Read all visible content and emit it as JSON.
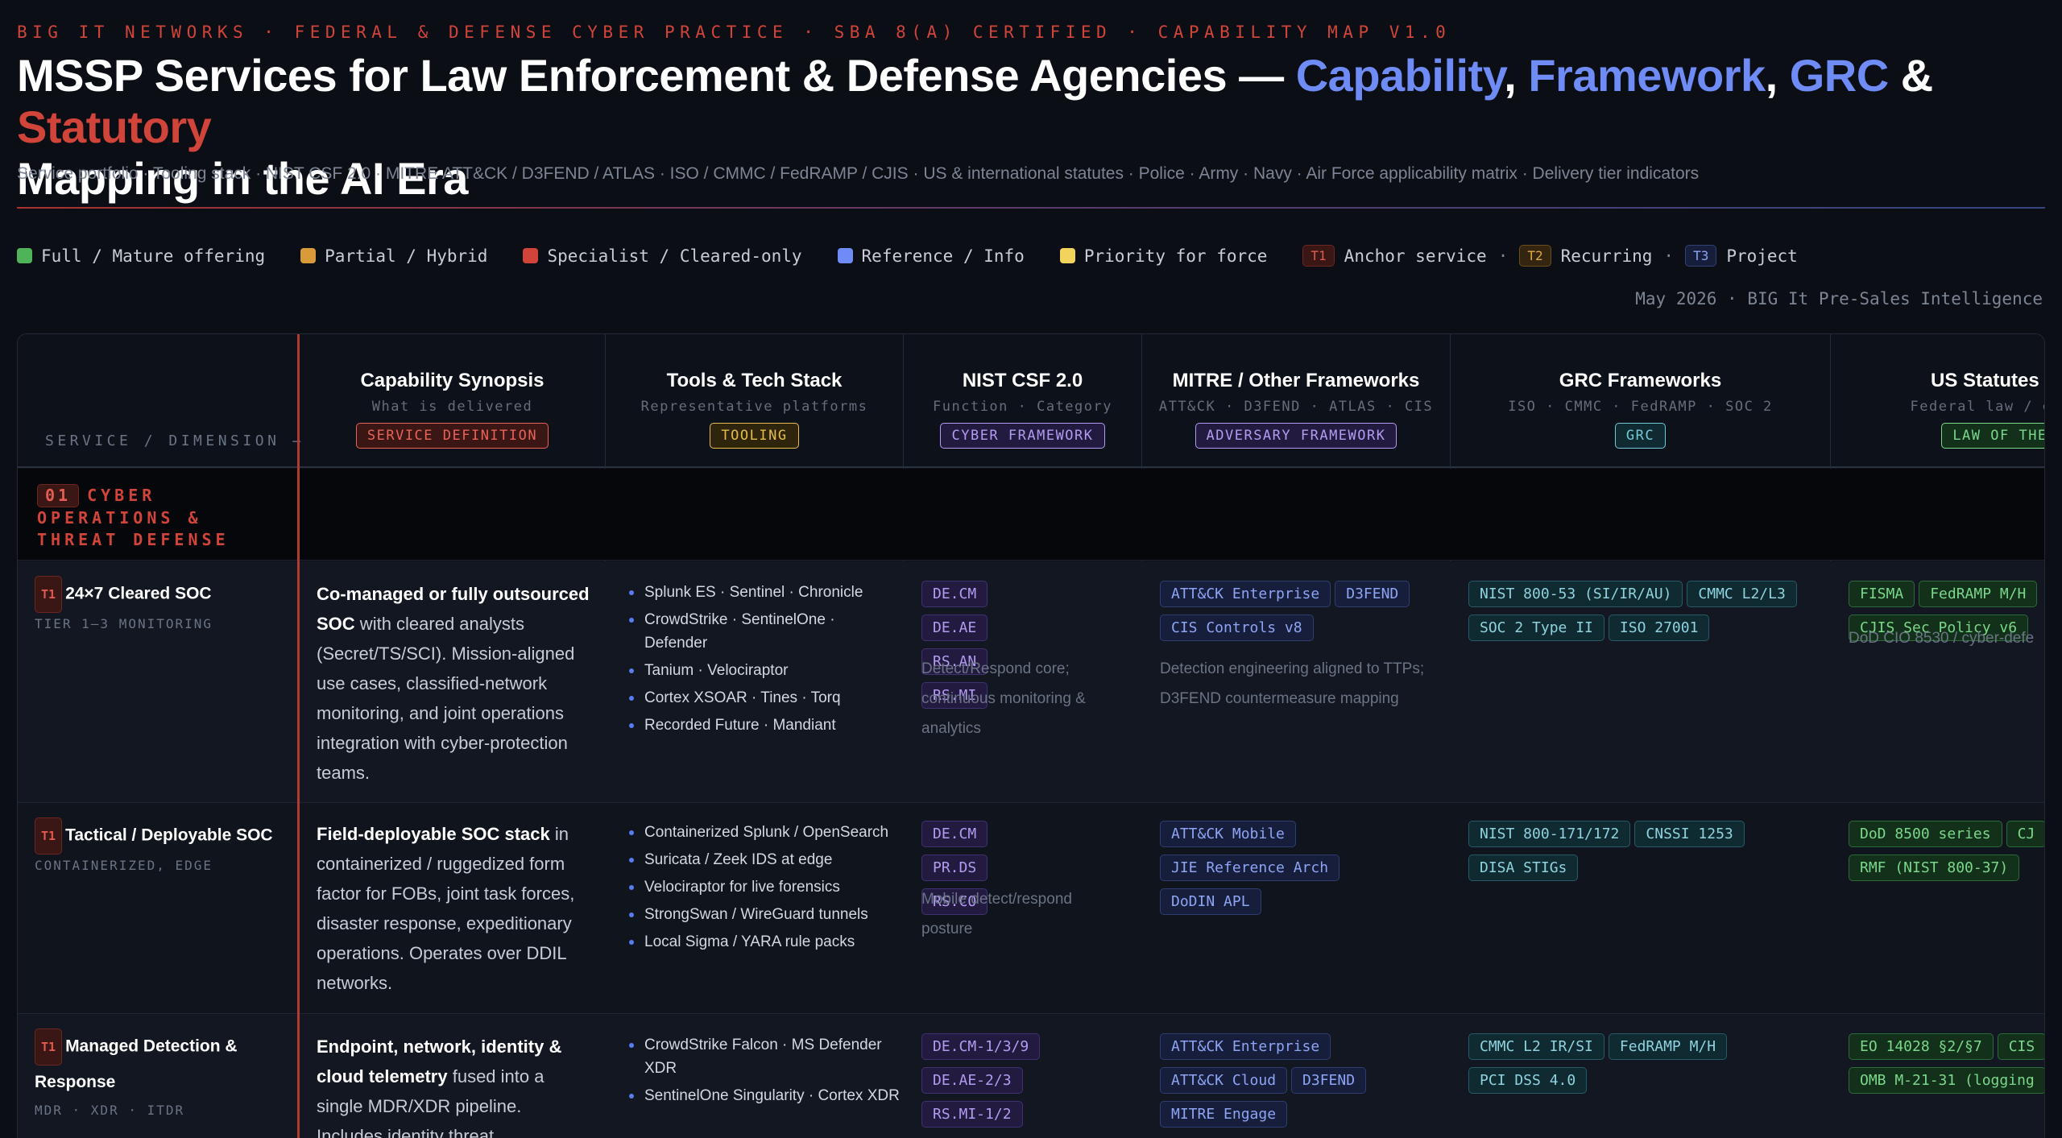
{
  "eyebrow": "BIG IT NETWORKS · FEDERAL & DEFENSE CYBER PRACTICE · SBA 8(A) CERTIFIED · CAPABILITY MAP V1.0",
  "title": {
    "main": "MSSP Services for Law Enforcement & Defense Agencies —",
    "w1": "Capability",
    "sep1": ",",
    "w2": "Framework",
    "sep2": ",",
    "w3": "GRC",
    "amp": "&",
    "w4": "Statutory",
    "tail": "Mapping in the AI Era"
  },
  "subtitle": "Service portfolio · Tooling stack · NIST CSF 2.0 · MITRE ATT&CK / D3FEND / ATLAS · ISO / CMMC / FedRAMP / CJIS · US & international statutes · Police · Army · Navy · Air Force applicability matrix · Delivery tier indicators",
  "legend": {
    "items": [
      {
        "label": "Full / Mature offering",
        "color": "#4fb35a"
      },
      {
        "label": "Partial / Hybrid",
        "color": "#d99a3a"
      },
      {
        "label": "Specialist / Cleared-only",
        "color": "#d0443a"
      },
      {
        "label": "Reference / Info",
        "color": "#6f8cf6"
      },
      {
        "label": "Priority for force",
        "color": "#f2d45c"
      }
    ],
    "tiers": [
      {
        "chip": "T1",
        "label": "Anchor service"
      },
      {
        "chip": "T2",
        "label": "Recurring"
      },
      {
        "chip": "T3",
        "label": "Project"
      }
    ],
    "dot": "·"
  },
  "dateline": "May 2026 · BIG It Pre-Sales Intelligence",
  "header": {
    "service_dim": "SERVICE / DIMENSION →",
    "cols": [
      {
        "title": "Capability Synopsis",
        "sub": "What is delivered",
        "badge": "SERVICE DEFINITION"
      },
      {
        "title": "Tools & Tech Stack",
        "sub": "Representative platforms",
        "badge": "TOOLING"
      },
      {
        "title": "NIST CSF 2.0",
        "sub": "Function · Category",
        "badge": "CYBER FRAMEWORK"
      },
      {
        "title": "MITRE / Other Frameworks",
        "sub": "ATT&CK · D3FEND · ATLAS · CIS",
        "badge": "ADVERSARY FRAMEWORK"
      },
      {
        "title": "GRC Frameworks",
        "sub": "ISO · CMMC · FedRAMP · SOC 2",
        "badge": "GRC"
      },
      {
        "title": "US Statutes & I",
        "sub": "Federal law / execu",
        "badge": "LAW OF THE"
      }
    ]
  },
  "section": {
    "num": "01",
    "label": "CYBER OPERATIONS & THREAT DEFENSE"
  },
  "rows": [
    {
      "tier": "T1",
      "name": "24×7 Cleared SOC",
      "sub": "TIER 1–3 MONITORING",
      "syn_bold": "Co-managed or fully outsourced SOC",
      "syn_rest": " with cleared analysts (Secret/TS/SCI). Mission-aligned use cases, classified-network monitoring, and joint operations integration with cyber-protection teams.",
      "tools": [
        "Splunk ES · Sentinel · Chronicle",
        "CrowdStrike · SentinelOne · Defender",
        "Tanium · Velociraptor",
        "Cortex XSOAR · Tines · Torq",
        "Recorded Future · Mandiant"
      ],
      "csf": [
        "DE.CM",
        "DE.AE",
        "RS.AN",
        "RS.MI"
      ],
      "csf_note": "Detect/Respond core; continuous monitoring & analytics",
      "mitre": [
        "ATT&CK Enterprise",
        "D3FEND",
        "CIS Controls v8"
      ],
      "mitre_note": "Detection engineering aligned to TTPs; D3FEND countermeasure mapping",
      "grc": [
        "NIST 800-53 (SI/IR/AU)",
        "CMMC L2/L3",
        "SOC 2 Type II",
        "ISO 27001"
      ],
      "law": [
        "FISMA",
        "FedRAMP M/H",
        "CJIS Sec Policy v6"
      ],
      "law_note": "DoD CIO 8530 / cyber-defe"
    },
    {
      "tier": "T1",
      "name": "Tactical / Deployable SOC",
      "sub": "CONTAINERIZED, EDGE",
      "syn_bold": "Field-deployable SOC stack",
      "syn_rest": " in containerized / ruggedized form factor for FOBs, joint task forces, disaster response, expeditionary operations. Operates over DDIL networks.",
      "tools": [
        "Containerized Splunk / OpenSearch",
        "Suricata / Zeek IDS at edge",
        "Velociraptor for live forensics",
        "StrongSwan / WireGuard tunnels",
        "Local Sigma / YARA rule packs"
      ],
      "csf": [
        "DE.CM",
        "PR.DS",
        "RS.CO"
      ],
      "csf_note": "Mobile detect/respond posture",
      "mitre": [
        "ATT&CK Mobile",
        "JIE Reference Arch",
        "DoDIN APL"
      ],
      "mitre_note": "",
      "grc": [
        "NIST 800-171/172",
        "CNSSI 1253",
        "DISA STIGs"
      ],
      "law": [
        "DoD 8500 series",
        "CJ",
        "RMF (NIST 800-37)"
      ],
      "law_note": ""
    },
    {
      "tier": "T1",
      "name": "Managed Detection & Response",
      "sub": "MDR · XDR · ITDR",
      "syn_bold": "Endpoint, network, identity & cloud telemetry",
      "syn_rest": " fused into a single MDR/XDR pipeline. Includes identity threat",
      "tools": [
        "CrowdStrike Falcon · MS Defender XDR",
        "SentinelOne Singularity · Cortex XDR"
      ],
      "csf": [
        "DE.CM-1/3/9",
        "DE.AE-2/3",
        "RS.MI-1/2"
      ],
      "csf_note": "",
      "mitre": [
        "ATT&CK Enterprise",
        "ATT&CK Cloud",
        "D3FEND",
        "MITRE Engage"
      ],
      "mitre_note": "",
      "grc": [
        "CMMC L2 IR/SI",
        "FedRAMP M/H",
        "PCI DSS 4.0"
      ],
      "law": [
        "EO 14028 §2/§7",
        "CIS",
        "OMB M-21-31 (logging"
      ],
      "law_note": ""
    }
  ]
}
